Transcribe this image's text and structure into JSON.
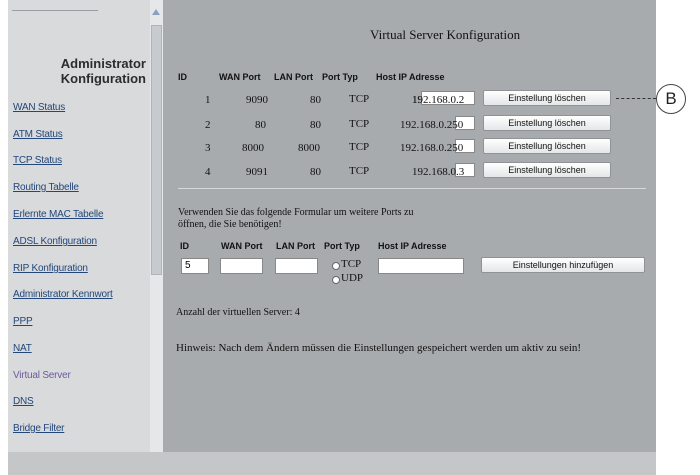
{
  "sidebar": {
    "title_line1": "Administrator",
    "title_line2": "Konfiguration",
    "items": [
      {
        "label": "WAN Status"
      },
      {
        "label": "ATM Status"
      },
      {
        "label": "TCP Status"
      },
      {
        "label": "Routing Tabelle"
      },
      {
        "label": "Erlernte MAC Tabelle"
      },
      {
        "label": "ADSL Konfiguration"
      },
      {
        "label": "RIP Konfiguration"
      },
      {
        "label": "Administrator Kennwort"
      },
      {
        "label": "PPP"
      },
      {
        "label": "NAT"
      },
      {
        "label": "Virtual Server"
      },
      {
        "label": "DNS"
      },
      {
        "label": "Bridge Filter"
      }
    ]
  },
  "main": {
    "title": "Virtual Server Konfiguration",
    "table": {
      "headers": {
        "id": "ID",
        "wan": "WAN Port",
        "lan": "LAN Port",
        "typ": "Port Typ",
        "host": "Host IP Adresse"
      },
      "rows": [
        {
          "id": "1",
          "wan": "9090",
          "lan": "80",
          "typ": "TCP",
          "host": "192.168.0.2",
          "button": "Einstellung löschen"
        },
        {
          "id": "2",
          "wan": "80",
          "lan": "80",
          "typ": "TCP",
          "host": "192.168.0.250",
          "button": "Einstellung löschen"
        },
        {
          "id": "3",
          "wan": "8000",
          "lan": "8000",
          "typ": "TCP",
          "host": "192.168.0.250",
          "button": "Einstellung löschen"
        },
        {
          "id": "4",
          "wan": "9091",
          "lan": "80",
          "typ": "TCP",
          "host": "192.168.0.3",
          "button": "Einstellung löschen"
        }
      ]
    },
    "form": {
      "intro_line1": "Verwenden Sie das folgende Formular um weitere Ports zu",
      "intro_line2": "öffnen, die Sie benötigen!",
      "headers": {
        "id": "ID",
        "wan": "WAN Port",
        "lan": "LAN Port",
        "typ": "Port Typ",
        "host": "Host IP Adresse"
      },
      "id_value": "5",
      "wan_value": "",
      "lan_value": "",
      "host_value": "",
      "radio_tcp": "TCP",
      "radio_udp": "UDP",
      "add_button": "Einstellungen hinzufügen"
    },
    "server_count": "Anzahl der virtuellen Server: 4",
    "hint": "Hinweis: Nach dem Ändern müssen die Einstellungen gespeichert werden um aktiv zu sein!"
  },
  "callout": {
    "label": "B"
  }
}
